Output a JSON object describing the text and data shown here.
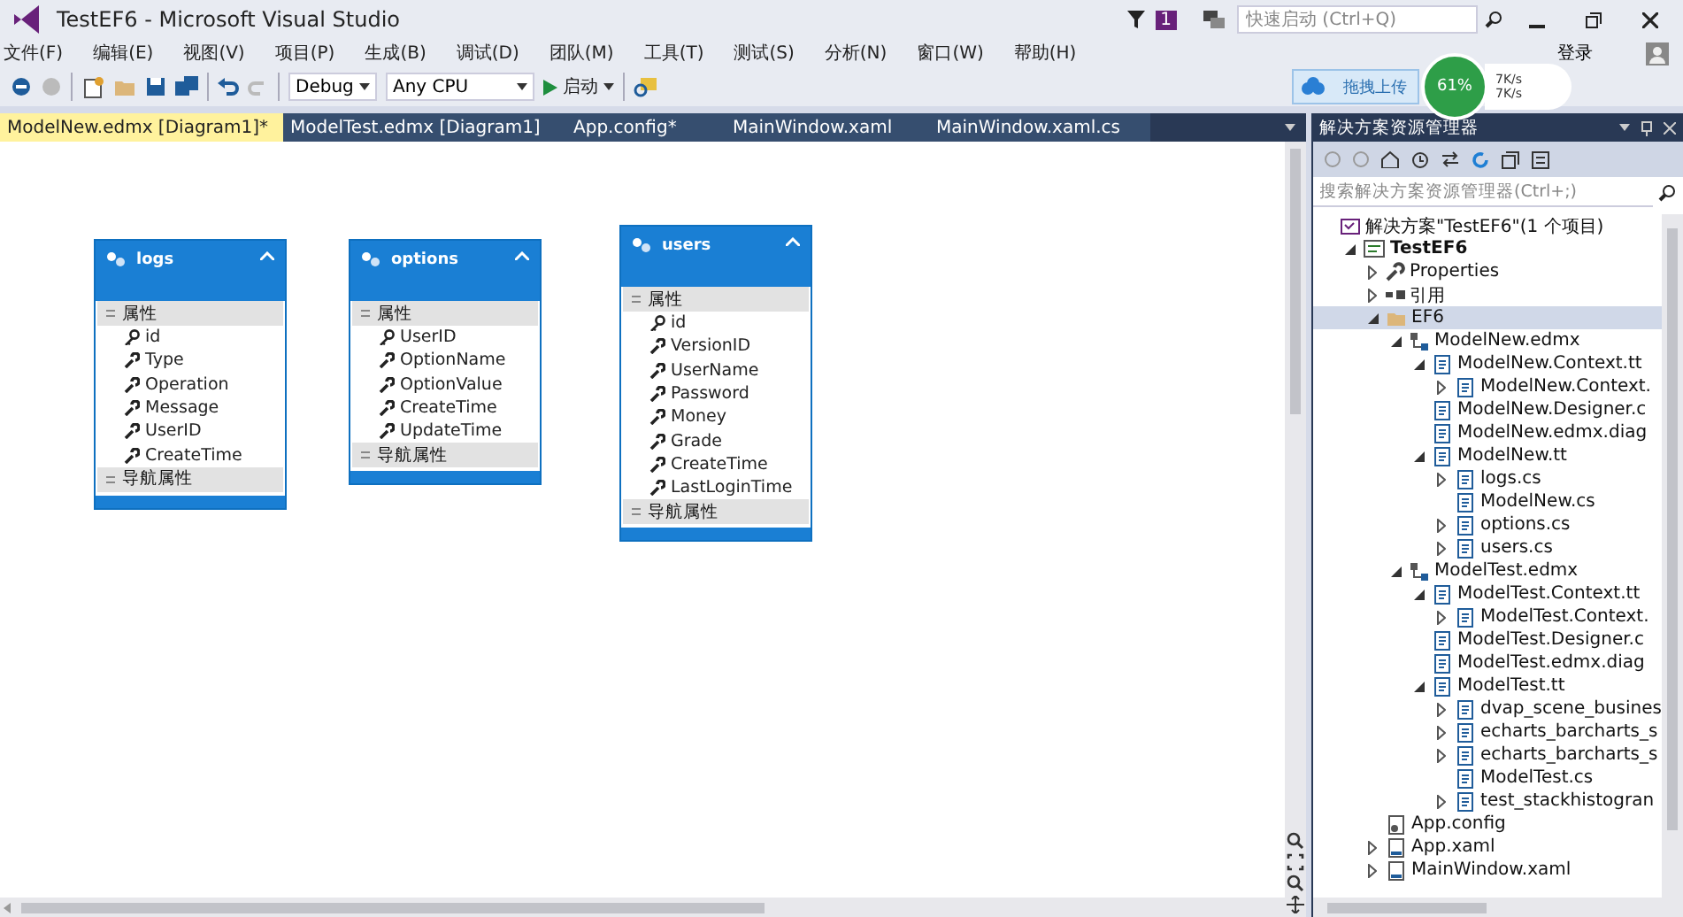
{
  "window": {
    "title": "TestEF6 - Microsoft Visual Studio",
    "notification_count": "1",
    "quick_launch": {
      "placeholder": "快速启动 (Ctrl+Q)"
    },
    "sign_in": "登录"
  },
  "menu": [
    "文件(F)",
    "编辑(E)",
    "视图(V)",
    "项目(P)",
    "生成(B)",
    "调试(D)",
    "团队(M)",
    "工具(T)",
    "测试(S)",
    "分析(N)",
    "窗口(W)",
    "帮助(H)"
  ],
  "toolbar": {
    "configuration": "Debug",
    "platform": "Any CPU",
    "start": "启动"
  },
  "upload_widget": {
    "label": "拖拽上传",
    "percent": "61%",
    "upload_speed": "7K/s",
    "download_speed": "7K/s"
  },
  "tabs": [
    {
      "label": "ModelNew.edmx [Diagram1]*",
      "selected": true
    },
    {
      "label": "ModelTest.edmx [Diagram1]",
      "selected": false
    },
    {
      "label": "App.config*",
      "selected": false
    },
    {
      "label": "MainWindow.xaml",
      "selected": false
    },
    {
      "label": "MainWindow.xaml.cs",
      "selected": false
    }
  ],
  "entities": [
    {
      "name": "logs",
      "sections": [
        {
          "title": "属性",
          "properties": [
            {
              "name": "id",
              "key": true
            },
            {
              "name": "Type",
              "key": false
            },
            {
              "name": "Operation",
              "key": false
            },
            {
              "name": "Message",
              "key": false
            },
            {
              "name": "UserID",
              "key": false
            },
            {
              "name": "CreateTime",
              "key": false
            }
          ]
        },
        {
          "title": "导航属性"
        }
      ]
    },
    {
      "name": "options",
      "sections": [
        {
          "title": "属性",
          "properties": [
            {
              "name": "UserID",
              "key": true
            },
            {
              "name": "OptionName",
              "key": false
            },
            {
              "name": "OptionValue",
              "key": false
            },
            {
              "name": "CreateTime",
              "key": false
            },
            {
              "name": "UpdateTime",
              "key": false
            }
          ]
        },
        {
          "title": "导航属性"
        }
      ]
    },
    {
      "name": "users",
      "sections": [
        {
          "title": "属性",
          "properties": [
            {
              "name": "id",
              "key": true
            },
            {
              "name": "VersionID",
              "key": false
            },
            {
              "name": "UserName",
              "key": false
            },
            {
              "name": "Password",
              "key": false
            },
            {
              "name": "Money",
              "key": false
            },
            {
              "name": "Grade",
              "key": false
            },
            {
              "name": "CreateTime",
              "key": false
            },
            {
              "name": "LastLoginTime",
              "key": false
            }
          ]
        },
        {
          "title": "导航属性"
        }
      ]
    }
  ],
  "solution_explorer": {
    "title": "解决方案资源管理器",
    "search": {
      "placeholder": "搜索解决方案资源管理器(Ctrl+;)"
    },
    "tree": [
      {
        "label": "解决方案\"TestEF6\"(1 个项目)",
        "kind": "solution",
        "selected": false,
        "children": [
          {
            "label": "TestEF6",
            "kind": "project",
            "bold": true,
            "expanded": true,
            "selected": false,
            "children": [
              {
                "label": "Properties",
                "kind": "wrench",
                "expanded": false,
                "selected": false
              },
              {
                "label": "引用",
                "kind": "refs",
                "expanded": false,
                "selected": false
              },
              {
                "label": "EF6",
                "kind": "folder",
                "expanded": true,
                "selected": true,
                "children": [
                  {
                    "label": "ModelNew.edmx",
                    "kind": "edmx",
                    "expanded": true,
                    "selected": false,
                    "children": [
                      {
                        "label": "ModelNew.Context.tt",
                        "kind": "file",
                        "expanded": true,
                        "selected": false,
                        "children": [
                          {
                            "label": "ModelNew.Context.",
                            "kind": "file",
                            "expanded": false,
                            "selected": false
                          }
                        ]
                      },
                      {
                        "label": "ModelNew.Designer.c",
                        "kind": "file",
                        "selected": false
                      },
                      {
                        "label": "ModelNew.edmx.diag",
                        "kind": "file",
                        "selected": false
                      },
                      {
                        "label": "ModelNew.tt",
                        "kind": "file",
                        "expanded": true,
                        "selected": false,
                        "children": [
                          {
                            "label": "logs.cs",
                            "kind": "file",
                            "expanded": false,
                            "selected": false
                          },
                          {
                            "label": "ModelNew.cs",
                            "kind": "file",
                            "selected": false
                          },
                          {
                            "label": "options.cs",
                            "kind": "file",
                            "expanded": false,
                            "selected": false
                          },
                          {
                            "label": "users.cs",
                            "kind": "file",
                            "expanded": false,
                            "selected": false
                          }
                        ]
                      }
                    ]
                  },
                  {
                    "label": "ModelTest.edmx",
                    "kind": "edmx",
                    "expanded": true,
                    "selected": false,
                    "children": [
                      {
                        "label": "ModelTest.Context.tt",
                        "kind": "file",
                        "expanded": true,
                        "selected": false,
                        "children": [
                          {
                            "label": "ModelTest.Context.",
                            "kind": "file",
                            "expanded": false,
                            "selected": false
                          }
                        ]
                      },
                      {
                        "label": "ModelTest.Designer.c",
                        "kind": "file",
                        "selected": false
                      },
                      {
                        "label": "ModelTest.edmx.diag",
                        "kind": "file",
                        "selected": false
                      },
                      {
                        "label": "ModelTest.tt",
                        "kind": "file",
                        "expanded": true,
                        "selected": false,
                        "children": [
                          {
                            "label": "dvap_scene_busines",
                            "kind": "file",
                            "expanded": false,
                            "selected": false
                          },
                          {
                            "label": "echarts_barcharts_s",
                            "kind": "file",
                            "expanded": false,
                            "selected": false
                          },
                          {
                            "label": "echarts_barcharts_s",
                            "kind": "file",
                            "expanded": false,
                            "selected": false
                          },
                          {
                            "label": "ModelTest.cs",
                            "kind": "file",
                            "selected": false
                          },
                          {
                            "label": "test_stackhistogran",
                            "kind": "file",
                            "expanded": false,
                            "selected": false
                          }
                        ]
                      }
                    ]
                  }
                ]
              },
              {
                "label": "App.config",
                "kind": "config",
                "selected": false
              },
              {
                "label": "App.xaml",
                "kind": "xaml",
                "expanded": false,
                "selected": false
              },
              {
                "label": "MainWindow.xaml",
                "kind": "xaml",
                "expanded": false,
                "selected": false
              }
            ]
          }
        ]
      }
    ]
  }
}
